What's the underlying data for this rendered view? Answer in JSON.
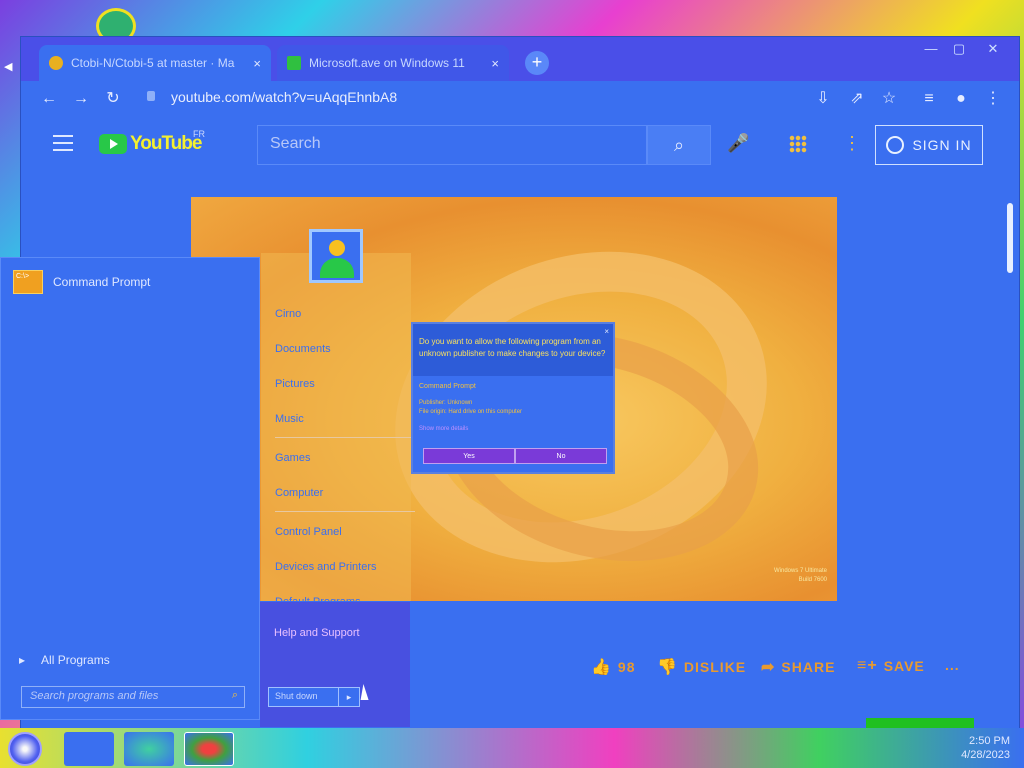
{
  "browser": {
    "tabs": [
      {
        "title": "Ctobi-N/Ctobi-5 at master · Ma",
        "close": "×"
      },
      {
        "title": "Microsoft.ave on Windows 11",
        "close": "×"
      }
    ],
    "new_tab": "+",
    "window_controls": [
      "—",
      "▢",
      "✕"
    ],
    "url": "youtube.com/watch?v=uAqqEhnbA8"
  },
  "youtube": {
    "logo_text": "YouTube",
    "country_code": "FR",
    "search_placeholder": "Search",
    "sign_in": "SIGN IN",
    "actions": {
      "like_count": "98",
      "dislike": "DISLIKE",
      "share": "SHARE",
      "save": "SAVE",
      "more": "..."
    }
  },
  "video": {
    "start_menu_right": [
      "Cirno",
      "Documents",
      "Pictures",
      "Music",
      "Games",
      "Computer",
      "Control Panel",
      "Devices and Printers",
      "Default Programs"
    ],
    "uac": {
      "question": "Do you want to allow the following program from an unknown publisher to make changes to your device?",
      "program": "Command Prompt",
      "publisher": "Publisher: Unknown",
      "origin": "File origin: Hard drive on this computer",
      "details": "Show more details",
      "yes": "Yes",
      "no": "No"
    },
    "watermark": "Windows 7 Ultimate\nBuild 7600"
  },
  "start_menu": {
    "pinned_program": "Command Prompt",
    "pinned_icon_label": "C:\\>",
    "all_programs": "All Programs",
    "search_placeholder": "Search programs and files",
    "help": "Help and Support",
    "shutdown": "Shut down",
    "shutdown_arrow": "▸"
  },
  "taskbar": {
    "time": "2:50 PM",
    "date": "4/28/2023"
  },
  "colors": {
    "browser_bg": "#3a6ff0",
    "video_bg": "#f0b040",
    "accent": "#f0c040"
  }
}
